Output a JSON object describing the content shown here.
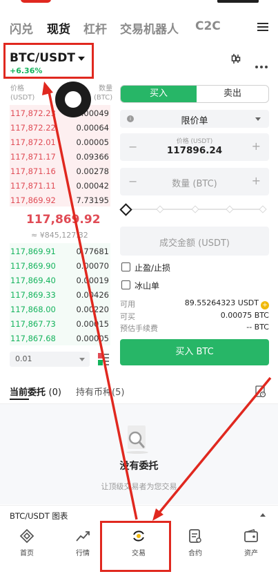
{
  "top_nav": {
    "tabs": [
      "闪兑",
      "现货",
      "杠杆",
      "交易机器人",
      "C2C"
    ],
    "active": "现货"
  },
  "pair": {
    "name": "BTC/USDT",
    "change": "+6.36%"
  },
  "order_book": {
    "price_header": [
      "价格",
      "(USDT)"
    ],
    "qty_header": [
      "数量",
      "(BTC)"
    ],
    "asks": [
      {
        "price": "117,872.23",
        "qty": "0.00049"
      },
      {
        "price": "117,872.22",
        "qty": "0.00064"
      },
      {
        "price": "117,872.01",
        "qty": "0.00005"
      },
      {
        "price": "117,871.17",
        "qty": "0.09366"
      },
      {
        "price": "117,871.16",
        "qty": "0.00278"
      },
      {
        "price": "117,871.11",
        "qty": "0.00042"
      },
      {
        "price": "117,869.92",
        "qty": "7.73195"
      }
    ],
    "mid_price": "117,869.92",
    "mid_fiat": "≈ ¥845,127.32",
    "bids": [
      {
        "price": "117,869.91",
        "qty": "0.77681"
      },
      {
        "price": "117,869.90",
        "qty": "0.00070"
      },
      {
        "price": "117,869.40",
        "qty": "0.00019"
      },
      {
        "price": "117,869.33",
        "qty": "0.00426"
      },
      {
        "price": "117,868.00",
        "qty": "0.00220"
      },
      {
        "price": "117,867.73",
        "qty": "0.00015"
      },
      {
        "price": "117,867.68",
        "qty": "0.00005"
      }
    ],
    "depth": "0.01"
  },
  "order_form": {
    "buy_tab": "买入",
    "sell_tab": "卖出",
    "order_type": "限价单",
    "price_label": "价格 (USDT)",
    "price_value": "117896.24",
    "qty_placeholder": "数量 (BTC)",
    "total_placeholder": "成交金额 (USDT)",
    "tp_sl": "止盈/止损",
    "iceberg": "冰山单",
    "available_label": "可用",
    "available_value": "89.55264323 USDT",
    "can_buy_label": "可买",
    "can_buy_value": "0.00075 BTC",
    "fee_label": "预估手续费",
    "fee_value": "-- BTC",
    "buy_button": "买入 BTC"
  },
  "orders_section": {
    "tab_open": "当前委托",
    "tab_open_count": "(0)",
    "tab_holdings": "持有币种",
    "tab_holdings_count": "(5)",
    "empty_title": "没有委托",
    "empty_sub": "让顶级交易者为您交易"
  },
  "chart_bar": {
    "label": "BTC/USDT 图表"
  },
  "bottom_nav": [
    {
      "label": "首页",
      "icon": "home-icon"
    },
    {
      "label": "行情",
      "icon": "markets-icon"
    },
    {
      "label": "交易",
      "icon": "trade-icon"
    },
    {
      "label": "合约",
      "icon": "futures-icon"
    },
    {
      "label": "资产",
      "icon": "wallet-icon"
    }
  ],
  "colors": {
    "accent_green": "#27b667",
    "ask_red": "#e04b55",
    "annotation_red": "#e0281f"
  }
}
